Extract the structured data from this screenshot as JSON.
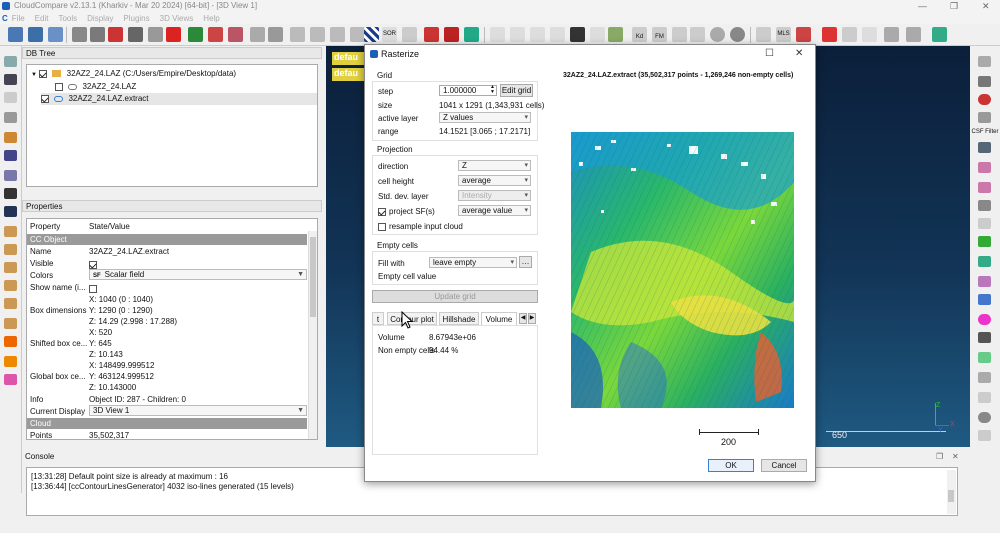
{
  "window": {
    "title": "CloudCompare v2.13.1 (Kharkiv - Mar 20 2024) [64-bit] - [3D View 1]"
  },
  "menu": [
    "File",
    "Edit",
    "Tools",
    "Display",
    "Plugins",
    "3D Views",
    "Help"
  ],
  "toolbar_labels": {
    "sor": "SOR",
    "kd": "Kd",
    "fm": "FM",
    "mls": "MLS"
  },
  "dbtree": {
    "title": "DB Tree",
    "items": [
      {
        "label": "32AZ2_24.LAZ (C:/Users/Empire/Desktop/data)"
      },
      {
        "label": "32AZ2_24.LAZ"
      },
      {
        "label": "32AZ2_24.LAZ.extract"
      }
    ]
  },
  "properties": {
    "title": "Properties",
    "col_property": "Property",
    "col_value": "State/Value",
    "section_cc": "CC Object",
    "section_cloud": "Cloud",
    "rows": {
      "name_k": "Name",
      "name_v": "32AZ2_24.LAZ.extract",
      "visible_k": "Visible",
      "colors_k": "Colors",
      "colors_v": "Scalar field",
      "showname_k": "Show name (i...",
      "boxdim_k": "Box dimensions",
      "boxdim_x": "X: 1040 (0 : 1040)",
      "boxdim_y": "Y: 1290 (0 : 1290)",
      "boxdim_z": "Z: 14.29 (2.998 : 17.288)",
      "shifted_k": "Shifted box ce...",
      "shifted_x": "X: 520",
      "shifted_y": "Y: 645",
      "shifted_z": "Z: 10.143",
      "global_k": "Global box ce...",
      "global_x": "X: 148499.999512",
      "global_y": "Y: 463124.999512",
      "global_z": "Z: 10.143000",
      "info_k": "Info",
      "info_v": "Object ID: 287 - Children: 0",
      "display_k": "Current Display",
      "display_v": "3D View 1",
      "points_k": "Points",
      "points_v": "35,502,317"
    }
  },
  "viewport": {
    "label1": "defau",
    "label2": "defau",
    "scale_label": "650",
    "axis_z": "Z",
    "axis_x": "X",
    "axis_y": "Y"
  },
  "righttools": {
    "csf_filter": "CSF Filter"
  },
  "console": {
    "title": "Console",
    "lines": [
      "[13:31:28] Default point size is already at maximum : 16",
      "[13:36:44] [ccContourLinesGenerator] 4032 iso-lines generated (15 levels)"
    ]
  },
  "rasterize": {
    "title": "Rasterize",
    "grid": {
      "title": "Grid",
      "step_label": "step",
      "step_value": "1.000000",
      "edit_grid": "Edit grid",
      "size_label": "size",
      "size_value": "1041 x 1291 (1,343,931 cells)",
      "active_layer_label": "active layer",
      "active_layer_value": "Z values",
      "range_label": "range",
      "range_value": "14.1521 [3.065 ; 17.2171]"
    },
    "projection": {
      "title": "Projection",
      "direction_label": "direction",
      "direction_value": "Z",
      "cell_height_label": "cell height",
      "cell_height_value": "average",
      "std_label": "Std. dev. layer",
      "std_value": "Intensity",
      "project_sf_label": "project SF(s)",
      "project_sf_value": "average value",
      "resample_label": "resample input cloud"
    },
    "empty": {
      "title": "Empty cells",
      "fill_label": "Fill with",
      "fill_value": "leave empty",
      "empty_value_label": "Empty cell value"
    },
    "update_grid": "Update grid",
    "tabs": {
      "t0": "t",
      "t1": "Contour plot",
      "t2": "Hillshade",
      "t3": "Volume"
    },
    "volume_label": "Volume",
    "volume_value": "8.67943e+06",
    "nonempty_label": "Non empty cells",
    "nonempty_value": "94.44 %",
    "preview_info": "32AZ2_24.LAZ.extract (35,502,317 points - 1,269,246 non-empty cells)",
    "scale_value": "200",
    "ok": "OK",
    "cancel": "Cancel"
  }
}
